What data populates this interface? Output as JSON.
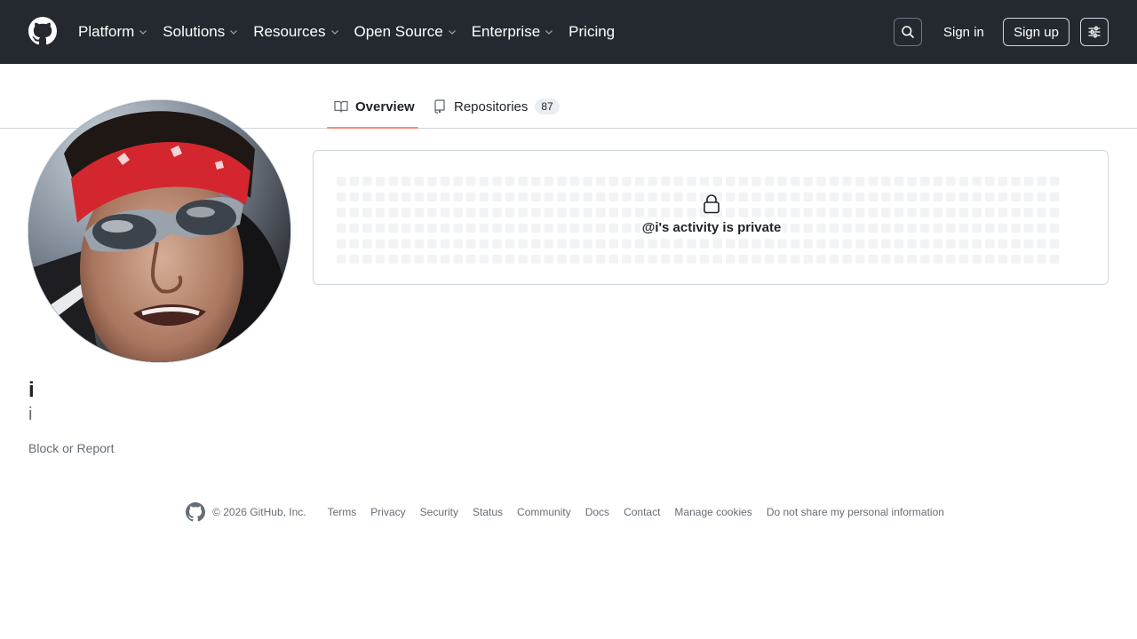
{
  "header": {
    "nav": [
      {
        "label": "Platform",
        "dropdown": true
      },
      {
        "label": "Solutions",
        "dropdown": true
      },
      {
        "label": "Resources",
        "dropdown": true
      },
      {
        "label": "Open Source",
        "dropdown": true
      },
      {
        "label": "Enterprise",
        "dropdown": true
      },
      {
        "label": "Pricing",
        "dropdown": false
      }
    ],
    "signin_label": "Sign in",
    "signup_label": "Sign up"
  },
  "tabs": {
    "overview_label": "Overview",
    "repositories_label": "Repositories",
    "repositories_count": "87"
  },
  "profile": {
    "name": "i",
    "login": "i",
    "block_label": "Block or Report"
  },
  "activity": {
    "private_text": "@i's activity is private"
  },
  "footer": {
    "copyright": "© 2026 GitHub, Inc.",
    "links": [
      "Terms",
      "Privacy",
      "Security",
      "Status",
      "Community",
      "Docs",
      "Contact",
      "Manage cookies",
      "Do not share my personal information"
    ]
  },
  "colors": {
    "header_bg": "#24292f",
    "tab_underline": "#fd8c73",
    "muted_text": "#656d76",
    "border": "#d0d7de"
  },
  "icons": {
    "logo": "github-mark-icon",
    "search": "search-icon",
    "menu": "sliders-icon",
    "overview": "book-icon",
    "repositories": "repo-icon",
    "private": "lock-icon"
  }
}
